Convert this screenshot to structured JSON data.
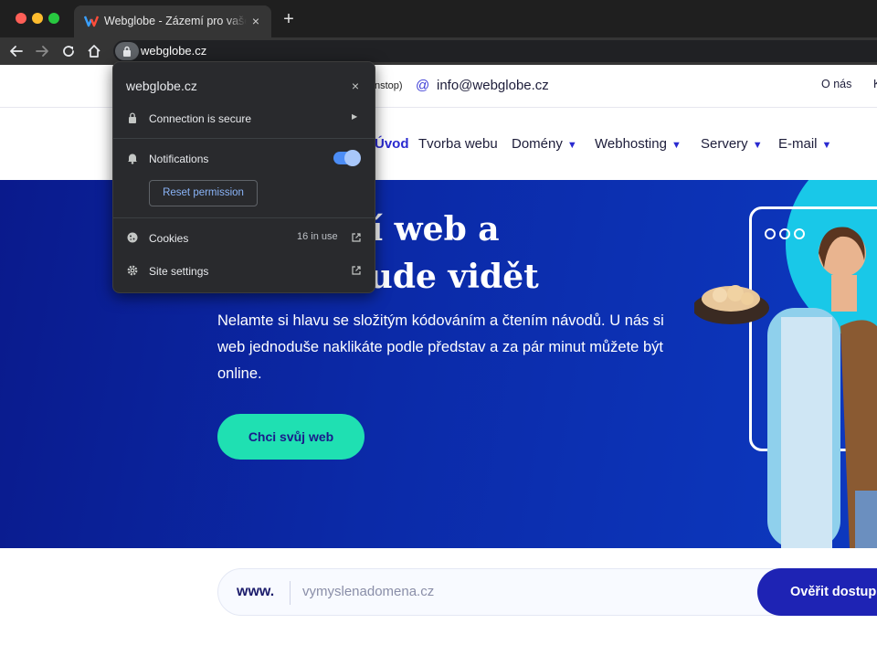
{
  "browser": {
    "tab": {
      "title": "Webglobe - Zázemí pro vaše online",
      "close_glyph": "×"
    },
    "new_tab_glyph": "+",
    "address_bar": {
      "url": "webglobe.cz"
    },
    "icons": [
      "back-arrow-icon",
      "forward-arrow-icon",
      "reload-icon",
      "home-icon",
      "lock-icon"
    ]
  },
  "site_info_popup": {
    "domain": "webglobe.cz",
    "close_glyph": "×",
    "connection_label": "Connection is secure",
    "notifications_label": "Notifications",
    "notifications_enabled": true,
    "reset_permission_label": "Reset permission",
    "cookies_label": "Cookies",
    "cookies_count": "16 in use",
    "site_settings_label": "Site settings"
  },
  "page": {
    "topbar": {
      "phone_tail": "nstop)",
      "email_icon": "@",
      "email": "info@webglobe.cz",
      "links": [
        "O nás",
        "K"
      ]
    },
    "nav": {
      "items": [
        {
          "label": "Úvod",
          "active": true,
          "has_caret": false
        },
        {
          "label": "Tvorba webu",
          "active": false,
          "has_caret": false
        },
        {
          "label": "Domény",
          "active": false,
          "has_caret": true
        },
        {
          "label": "Webhosting",
          "active": false,
          "has_caret": true
        },
        {
          "label": "Servery",
          "active": false,
          "has_caret": true
        },
        {
          "label": "E-mail",
          "active": false,
          "has_caret": true
        }
      ]
    },
    "hero": {
      "title_line1": "si vlastní web a",
      "title_line2": "nikání bude vidět",
      "text": "Nelamte si hlavu se složitým kódováním a čtením návodů. U nás si web jednoduše naklikáte podle představ a za pár minut můžete být online.",
      "cta_label": "Chci svůj web"
    },
    "domain_search": {
      "prefix": "www.",
      "placeholder": "vymyslenadomena.cz",
      "button_label": "Ověřit dostupnost"
    }
  },
  "colors": {
    "chrome_dark": "#1f1f1f",
    "toolbar": "#353535",
    "popup_bg": "#292a2d",
    "hero_blue": "#0b2aa8",
    "cta_green": "#1fe0b2",
    "brand_blue": "#2a2ad0",
    "toggle_blue": "#4c8df6"
  }
}
